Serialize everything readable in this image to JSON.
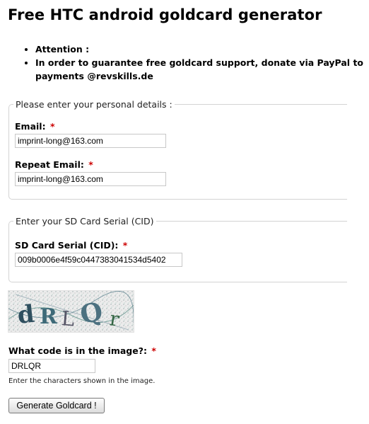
{
  "page": {
    "title": "Free HTC android goldcard generator"
  },
  "notes": [
    "Attention :",
    "In order to guarantee free goldcard support, donate via PayPal to payments @revskills.de"
  ],
  "personal": {
    "legend": "Please enter your personal details :",
    "email_label": "Email:",
    "email_value": "imprint-long@163.com",
    "repeat_label": "Repeat Email:",
    "repeat_value": "imprint-long@163.com"
  },
  "sd": {
    "legend": "Enter your SD Card Serial (CID)",
    "label": "SD Card Serial (CID):",
    "value": "009b0006e4f59c0447383041534d5402"
  },
  "captcha": {
    "text": "DRLQR",
    "question_label": "What code is in the image?:",
    "answer": "DRLQR",
    "hint": "Enter the characters shown in the image."
  },
  "button": {
    "label": "Generate Goldcard !"
  },
  "required_mark": "*",
  "colors": {
    "required": "#cc0000",
    "border": "#d3d3d3"
  }
}
